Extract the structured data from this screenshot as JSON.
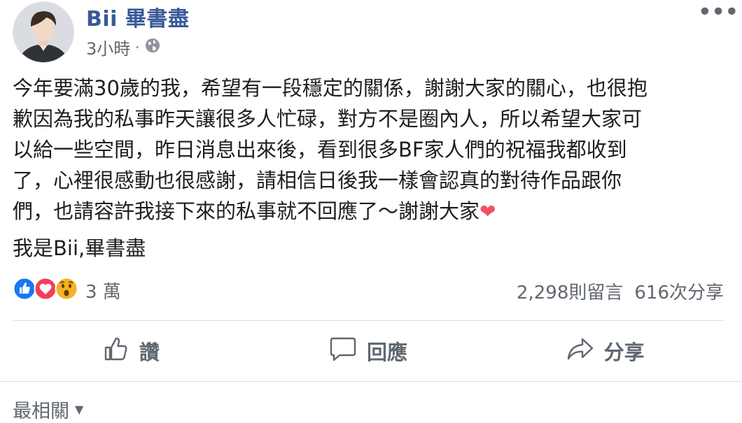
{
  "post": {
    "author": "Bii 畢書盡",
    "time": "3小時",
    "separator": "·",
    "audience_icon": "globe-icon",
    "more_icon": "more-options-icon",
    "body": "今年要滿30歲的我，希望有一段穩定的關係，謝謝大家的關心，也很抱\n歉因為我的私事昨天讓很多人忙碌，對方不是圈內人，所以希望大家可\n以給一些空間，昨日消息出來後，看到很多BF家人們的祝福我都收到\n了，心裡很感動也很感謝，請相信日後我一樣會認真的對待作品跟你\n們，也請容許我接下來的私事就不回應了～謝謝大家",
    "heart": "❤",
    "signature": "我是Bii,畢書盡"
  },
  "reactions": {
    "icons": [
      "like-icon",
      "love-icon",
      "wow-icon"
    ],
    "count": "3 萬",
    "comments": "2,298則留言",
    "shares": "616次分享"
  },
  "actions": {
    "like": "讚",
    "comment": "回應",
    "share": "分享"
  },
  "comments_sort": {
    "label": "最相關",
    "caret": "▼"
  },
  "colors": {
    "author_blue": "#385898",
    "like_blue": "#1877f2",
    "love_red": "#f33e58",
    "wow_yellow": "#f7b125",
    "muted": "#606770"
  }
}
